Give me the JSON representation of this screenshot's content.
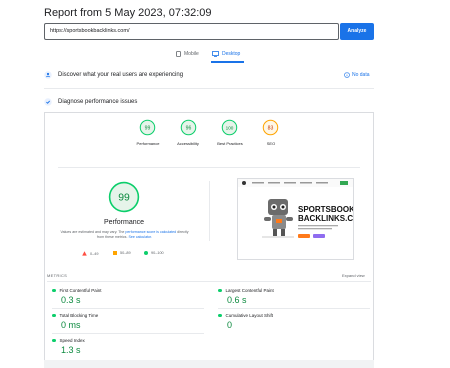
{
  "header": {
    "title": "Report from 5 May 2023, 07:32:09"
  },
  "search": {
    "value": "https://sportsbookbacklinks.com/",
    "button_label": "Analyze"
  },
  "tabs": [
    {
      "label": "Mobile",
      "active": false
    },
    {
      "label": "Desktop",
      "active": true
    }
  ],
  "sections": {
    "field_data": {
      "title": "Discover what your real users are experiencing",
      "no_data": "No data"
    },
    "diagnose": {
      "title": "Diagnose performance issues"
    }
  },
  "gauges": [
    {
      "score": "99",
      "label": "Performance"
    },
    {
      "score": "96",
      "label": "Accessibility"
    },
    {
      "score": "100",
      "label": "Best Practices"
    },
    {
      "score": "83",
      "label": "SEO"
    }
  ],
  "performance": {
    "score": "99",
    "title": "Performance",
    "note_prefix": "Values are estimated and may vary. The ",
    "note_link": "performance score is calculated",
    "note_middle": " directly from these metrics. ",
    "note_link2": "See calculator."
  },
  "legend": [
    {
      "range": "0–49",
      "color": "#ff4e42"
    },
    {
      "range": "50–89",
      "color": "#ffa400"
    },
    {
      "range": "90–100",
      "color": "#0cce6b"
    }
  ],
  "thumbnail": {
    "brand_line1": "SPORTSBOOK",
    "brand_line2": "BACKLINKS.COM"
  },
  "metrics": {
    "label": "METRICS",
    "expand": "Expand view",
    "items": [
      {
        "name": "First Contentful Paint",
        "value": "0.3 s"
      },
      {
        "name": "Largest Contentful Paint",
        "value": "0.6 s"
      },
      {
        "name": "Total Blocking Time",
        "value": "0 ms"
      },
      {
        "name": "Cumulative Layout Shift",
        "value": "0"
      },
      {
        "name": "Speed Index",
        "value": "1.3 s"
      }
    ]
  },
  "colors": {
    "accent": "#1a73e8",
    "good": "#0cce6b",
    "average": "#ffa400",
    "good_text": "#0c8a3f",
    "average_text": "#c33300"
  }
}
